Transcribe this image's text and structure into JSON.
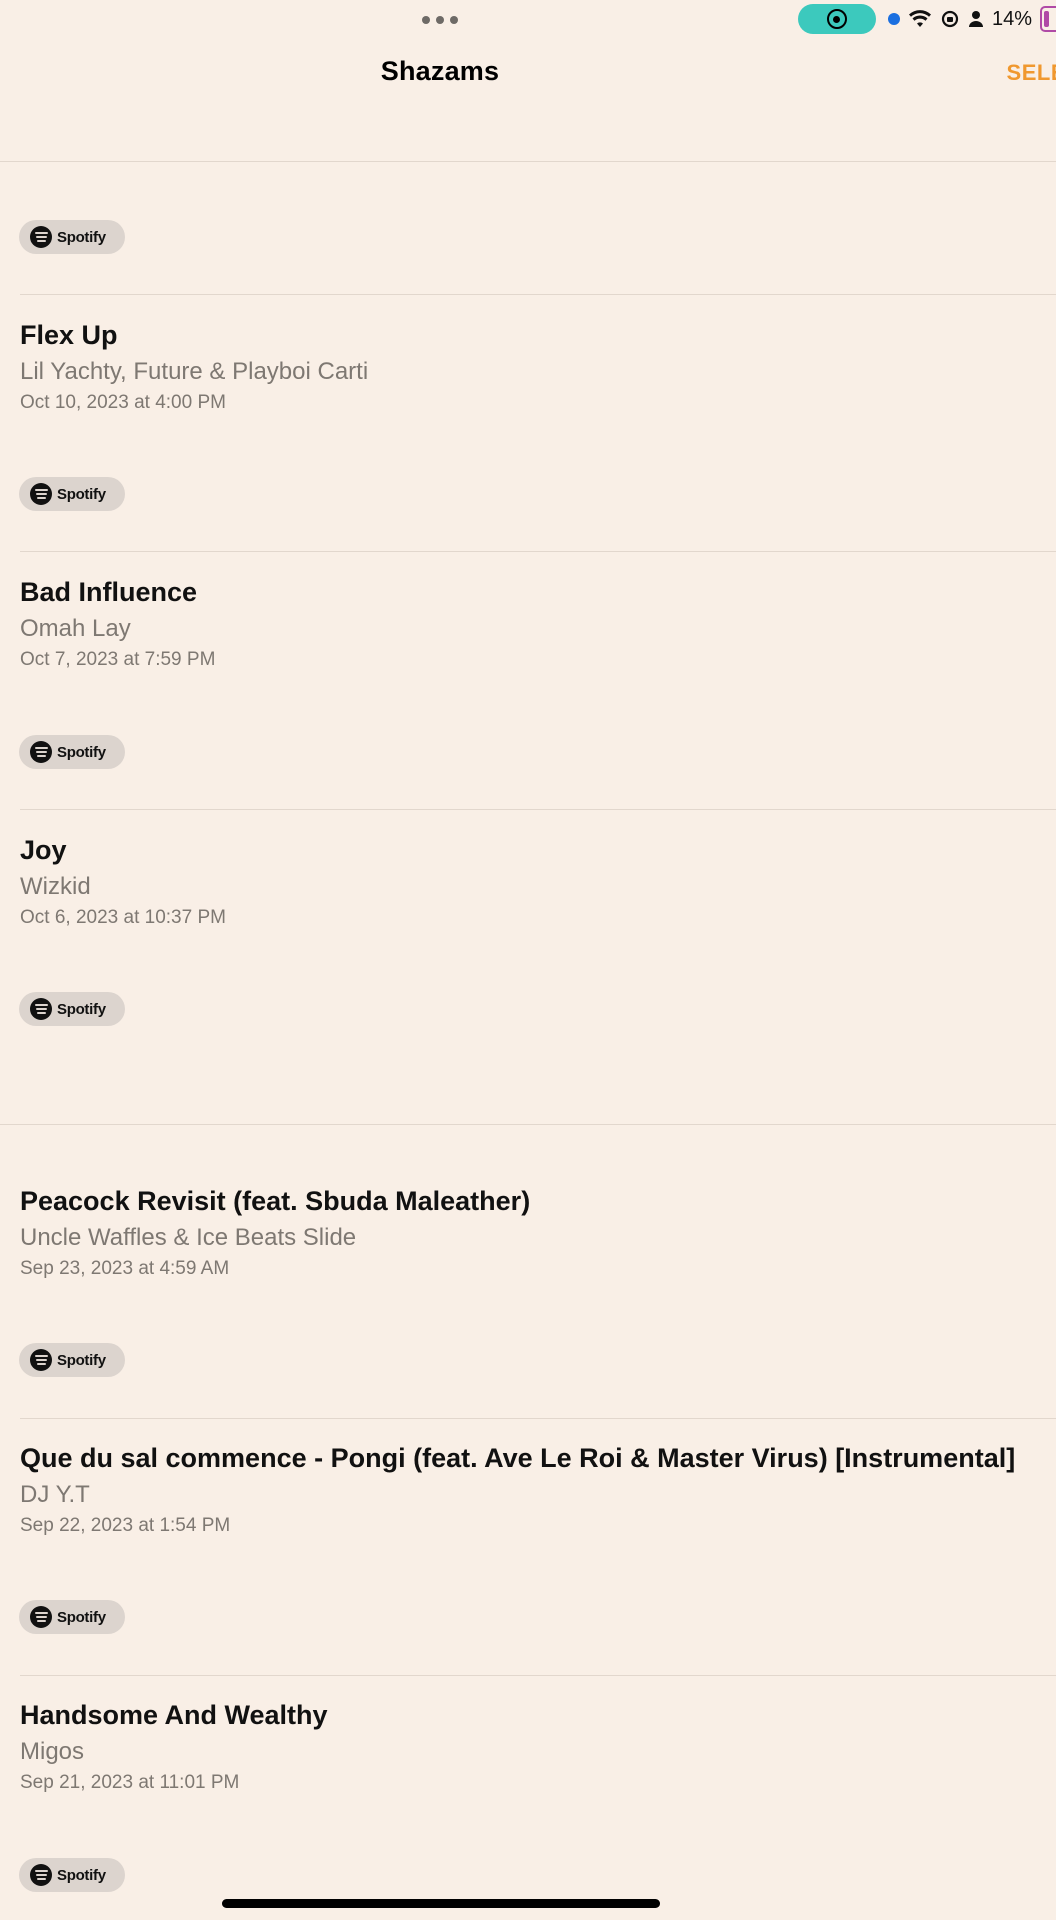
{
  "status_bar": {
    "battery_percent": "14%"
  },
  "nav": {
    "title": "Shazams",
    "select_label": "SELE"
  },
  "spotify_label": "Spotify",
  "songs": [
    {
      "title": "Flex Up",
      "artist": "Lil Yachty, Future & Playboi Carti",
      "date": "Oct 10, 2023 at 4:00 PM"
    },
    {
      "title": "Bad Influence",
      "artist": "Omah Lay",
      "date": "Oct 7, 2023 at 7:59 PM"
    },
    {
      "title": "Joy",
      "artist": "Wizkid",
      "date": "Oct 6, 2023 at 10:37 PM"
    },
    {
      "title": "Peacock Revisit (feat. Sbuda Maleather)",
      "artist": "Uncle Waffles & Ice Beats Slide",
      "date": "Sep 23, 2023 at 4:59 AM"
    },
    {
      "title": "Que du sal commence - Pongi (feat. Ave Le Roi & Master Virus) [Instrumental]",
      "artist": "DJ Y.T",
      "date": "Sep 22, 2023 at 1:54 PM"
    },
    {
      "title": "Handsome And Wealthy",
      "artist": "Migos",
      "date": "Sep 21, 2023 at 11:01 PM"
    }
  ],
  "colors": {
    "background": "#f9efe6",
    "accent": "#f0982f",
    "record_pill": "#3cc9bd"
  }
}
